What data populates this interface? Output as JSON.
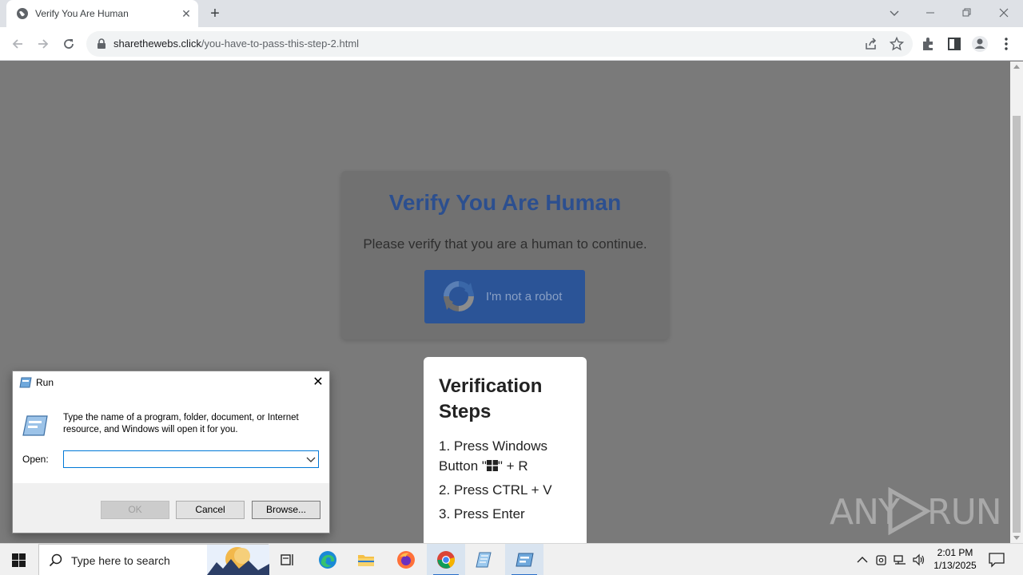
{
  "browser": {
    "tab_title": "Verify You Are Human",
    "tab_close": "✕",
    "new_tab": "+",
    "url_host": "sharethewebs.click",
    "url_path": "/you-have-to-pass-this-step-2.html"
  },
  "page": {
    "heading": "Verify You Are Human",
    "subtext": "Please verify that you are a human to continue.",
    "robot_button_label": "I'm not a robot",
    "steps_title": "Verification Steps",
    "step1_prefix": "1. Press Windows",
    "step1_suffix_a": "Button \"",
    "step1_suffix_b": "\" + R",
    "step2": "2. Press CTRL + V",
    "step3": "3. Press Enter",
    "watermark_left": "ANY",
    "watermark_right": "RUN"
  },
  "run_dialog": {
    "title": "Run",
    "close": "✕",
    "description": "Type the name of a program, folder, document, or Internet resource, and Windows will open it for you.",
    "open_label": "Open:",
    "open_value": "",
    "ok_label": "OK",
    "cancel_label": "Cancel",
    "browse_label": "Browse..."
  },
  "taskbar": {
    "search_placeholder": "Type here to search",
    "time": "2:01 PM",
    "date": "1/13/2025"
  },
  "colors": {
    "accent": "#2b5497",
    "heading": "#2c4f8f",
    "overlay": "#7a7a7a"
  }
}
